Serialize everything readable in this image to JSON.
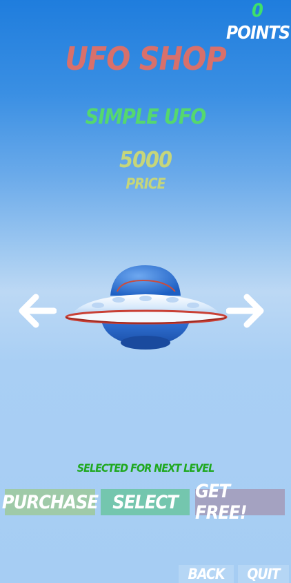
{
  "hud": {
    "points_value": "0",
    "points_label": "POINTS"
  },
  "shop": {
    "title": "UFO SHOP",
    "item_name": "SIMPLE UFO",
    "price_value": "5000",
    "price_label": "PRICE"
  },
  "status": "SELECTED FOR NEXT LEVEL",
  "actions": {
    "purchase": "PURCHASE",
    "select": "SELECT",
    "get_free": "GET FREE!"
  },
  "nav": {
    "back": "BACK",
    "quit": "QUIT"
  },
  "icons": {
    "prev": "arrow-left-icon",
    "next": "arrow-right-icon",
    "preview": "ufo-model"
  },
  "colors": {
    "title": "#d8706b",
    "item_name": "#55d86e",
    "price": "#c6d67a",
    "points_value": "#3ee06a",
    "status": "#1fa81f",
    "purchase_bg": "#9fcaa8",
    "select_bg": "#74c6ae",
    "get_free_bg": "#a4a2c1"
  }
}
